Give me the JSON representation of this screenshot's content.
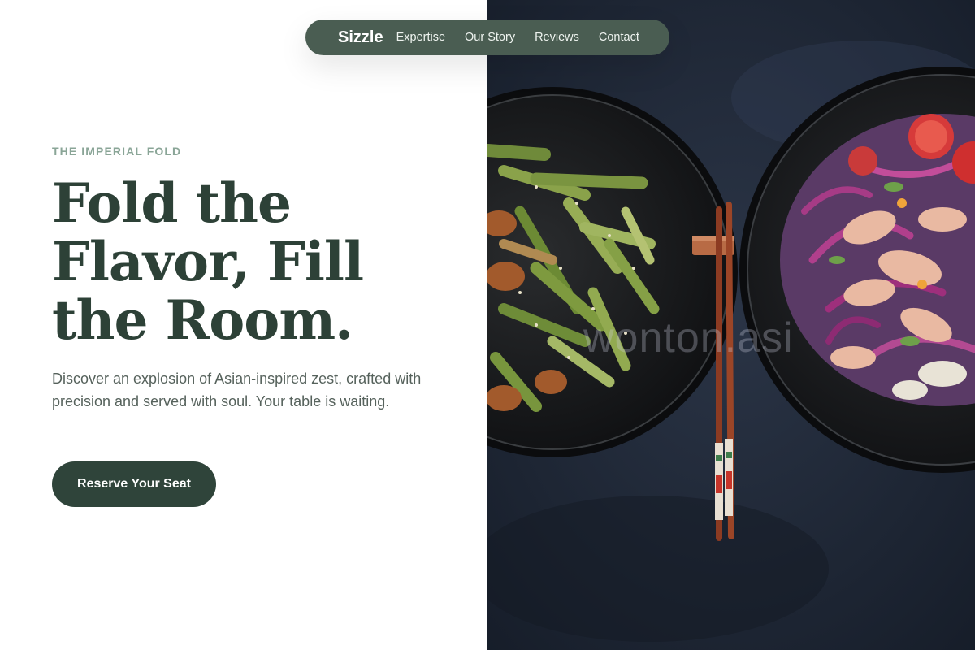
{
  "nav": {
    "brand": "Sizzle",
    "links": [
      "Expertise",
      "Our Story",
      "Reviews",
      "Contact"
    ]
  },
  "hero": {
    "eyebrow": "THE IMPERIAL FOLD",
    "headline_lines": [
      "Fold the",
      "Flavor, Fill",
      "the Room."
    ],
    "intro": "Discover an explosion of Asian-inspired zest, crafted with precision and served with soul. Your table is waiting.",
    "cta_label": "Reserve Your Seat"
  },
  "image": {
    "watermark": "wonton.asi"
  },
  "colors": {
    "accent_dark_green": "#2f443a",
    "nav_pill": "#4a5d52",
    "eyebrow_green": "#8aa597",
    "photo_background": "#1e2736"
  },
  "icons": [
    "bowl-green-beans",
    "bowl-slaw",
    "chopsticks"
  ]
}
